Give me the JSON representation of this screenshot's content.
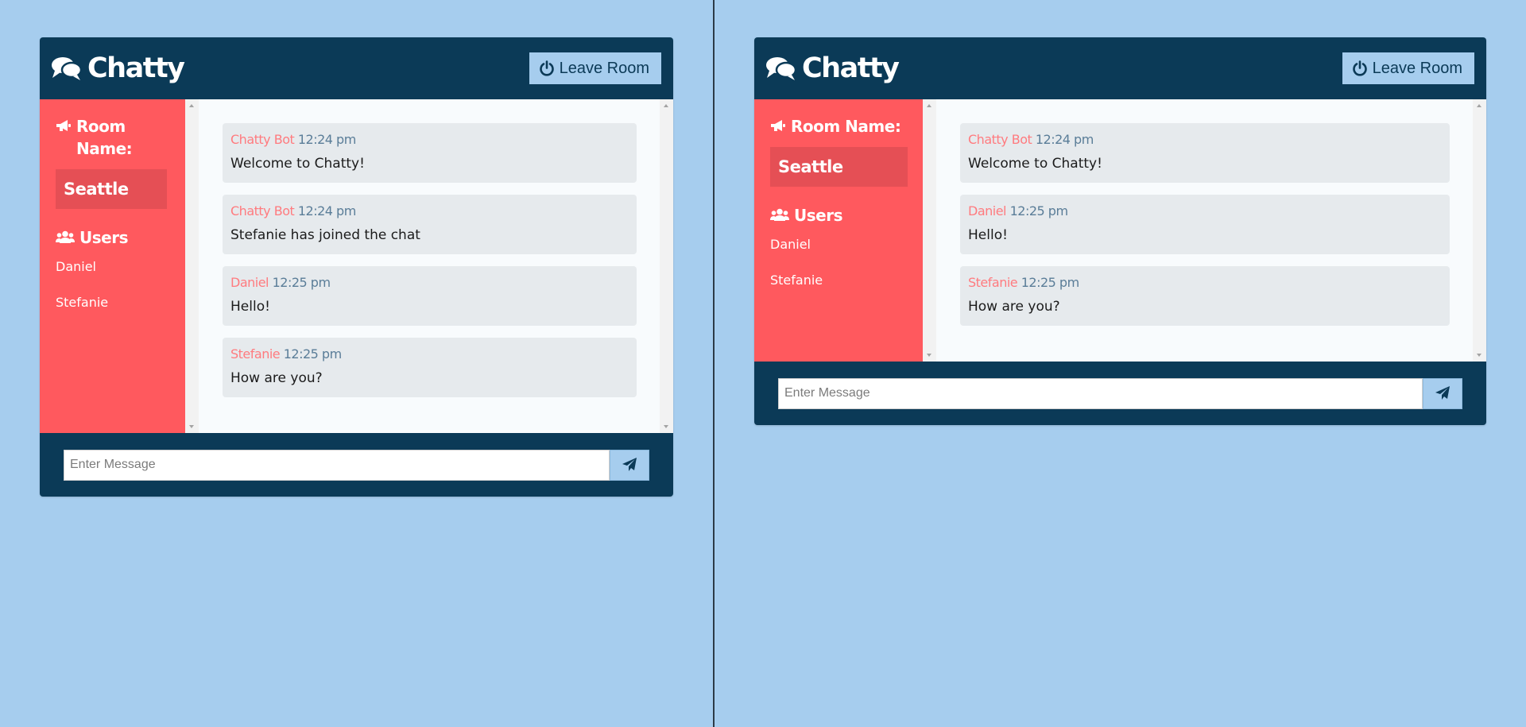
{
  "windows": [
    {
      "app_name": "Chatty",
      "leave_label": "Leave Room",
      "room_label": "Room Name:",
      "room_name": "Seattle",
      "users_label": "Users",
      "users": [
        "Daniel",
        "Stefanie"
      ],
      "messages": [
        {
          "author": "Chatty Bot",
          "time": "12:24 pm",
          "text": "Welcome to Chatty!"
        },
        {
          "author": "Chatty Bot",
          "time": "12:24 pm",
          "text": "Stefanie has joined the chat"
        },
        {
          "author": "Daniel",
          "time": "12:25 pm",
          "text": "Hello!"
        },
        {
          "author": "Stefanie",
          "time": "12:25 pm",
          "text": "How are you?"
        }
      ],
      "input_placeholder": "Enter Message"
    },
    {
      "app_name": "Chatty",
      "leave_label": "Leave Room",
      "room_label": "Room Name:",
      "room_name": "Seattle",
      "users_label": "Users",
      "users": [
        "Daniel",
        "Stefanie"
      ],
      "messages": [
        {
          "author": "Chatty Bot",
          "time": "12:24 pm",
          "text": "Welcome to Chatty!"
        },
        {
          "author": "Daniel",
          "time": "12:25 pm",
          "text": "Hello!"
        },
        {
          "author": "Stefanie",
          "time": "12:25 pm",
          "text": "How are you?"
        }
      ],
      "input_placeholder": "Enter Message"
    }
  ],
  "colors": {
    "page_background": "#a6cdee",
    "header_background": "#0b3a57",
    "sidebar_background": "#ff595e",
    "room_box": "#e54f55",
    "message_background": "#e6eaed",
    "author_name": "#ff7b7f",
    "timestamp": "#5a7d98"
  },
  "icons": {
    "brand": "comments-icon",
    "leave": "power-icon",
    "room": "bullhorn-icon",
    "users": "users-icon",
    "send": "paper-plane-icon"
  }
}
